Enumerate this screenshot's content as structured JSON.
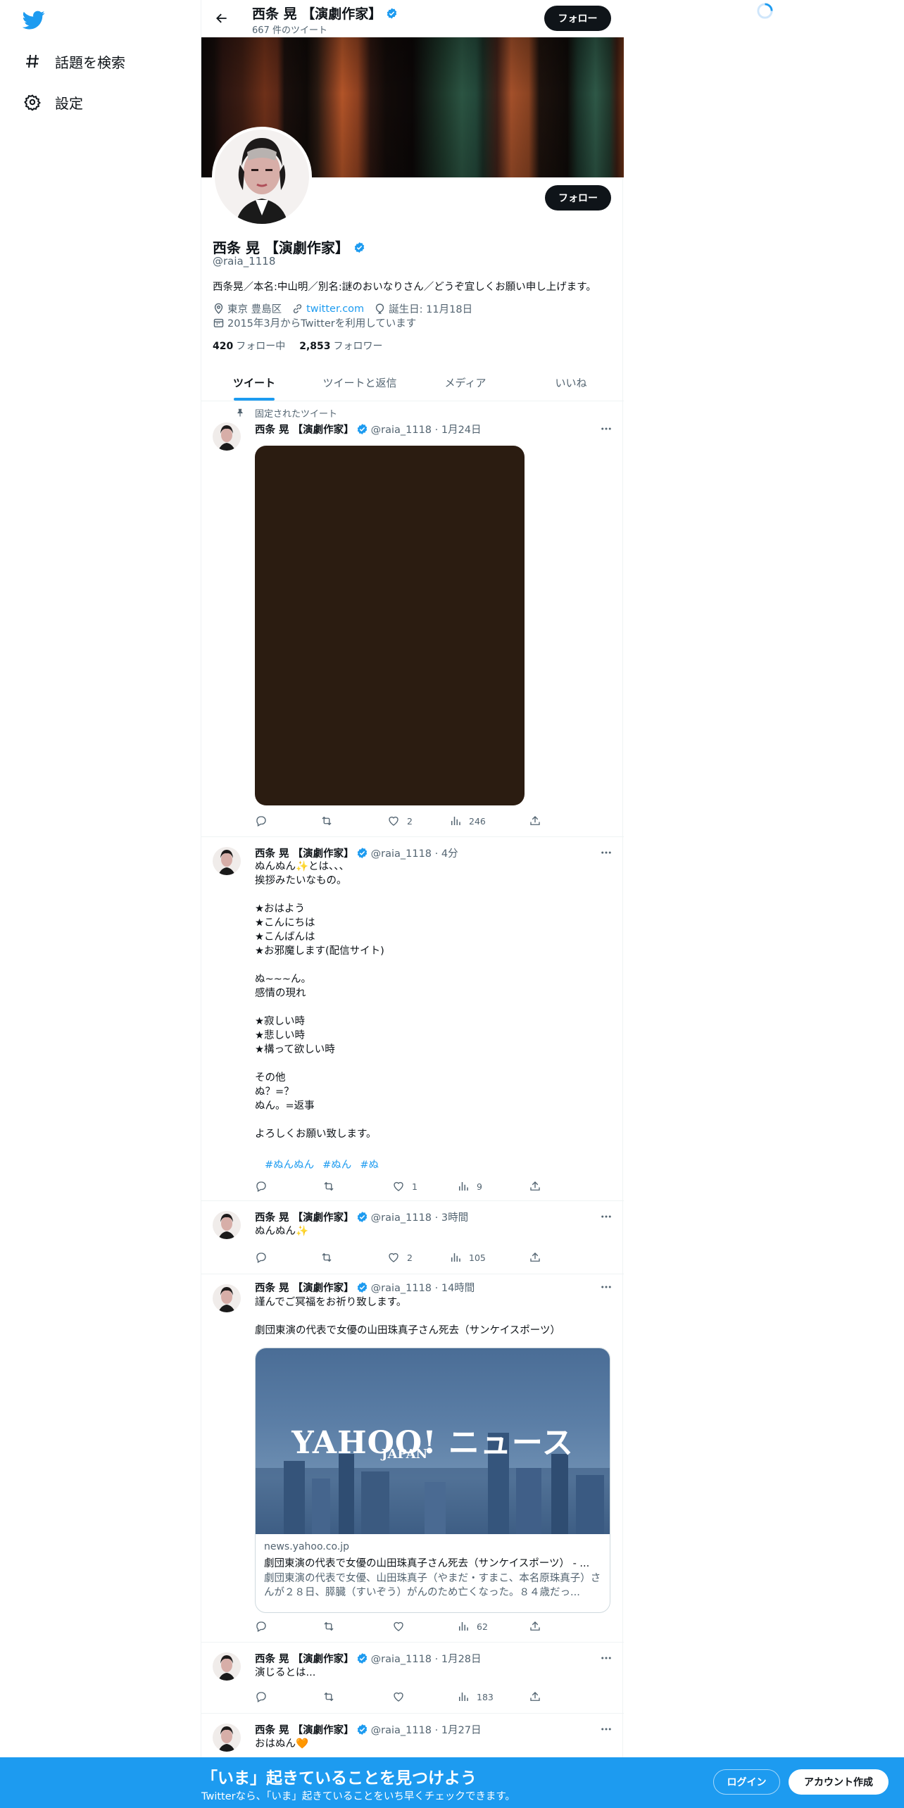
{
  "nav": {
    "logo_icon": "twitter-bird-icon",
    "items": [
      {
        "label": "話題を検索",
        "icon": "hashtag-icon"
      },
      {
        "label": "設定",
        "icon": "gear-icon"
      }
    ]
  },
  "header": {
    "name": "西条 晃 【演劇作家】",
    "tweet_count": "667 件のツイート",
    "follow_label": "フォロー"
  },
  "profile": {
    "name": "西条 晃 【演劇作家】",
    "handle": "@raia_1118",
    "follow_label": "フォロー",
    "bio": "西条晃／本名:中山明／別名:謎のおいなりさん／どうぞ宜しくお願い申し上げます。",
    "location": "東京 豊島区",
    "url": "twitter.com",
    "birthday": "誕生日: 11月18日",
    "joined": "2015年3月からTwitterを利用しています",
    "following_count": "420",
    "following_label": "フォロー中",
    "followers_count": "2,853",
    "followers_label": "フォロワー"
  },
  "tabs": [
    {
      "label": "ツイート",
      "active": true
    },
    {
      "label": "ツイートと返信",
      "active": false
    },
    {
      "label": "メディア",
      "active": false
    },
    {
      "label": "いいね",
      "active": false
    }
  ],
  "tweets": [
    {
      "pinned_label": "固定されたツイート",
      "name": "西条 晃 【演劇作家】",
      "meta": "@raia_1118 · 1月24日",
      "text": "",
      "replies": "",
      "retweets": "",
      "likes": "2",
      "views": "246"
    },
    {
      "name": "西条 晃 【演劇作家】",
      "meta": "@raia_1118 · 4分",
      "text": "ぬんぬん✨とは、、、\n挨拶みたいなもの。\n\n★おはよう\n★こんにちは\n★こんばんは\n★お邪魔します(配信サイト)\n\nぬ~~~ん。\n感情の現れ\n\n★寂しい時\n★悲しい時\n★構って欲しい時\n\nその他\nぬ？=？\nぬん。=返事\n\nよろしくお願い致します。",
      "hashtags": [
        "#ぬんぬん",
        "#ぬん",
        "#ぬ"
      ],
      "replies": "",
      "retweets": "",
      "likes": "1",
      "views": "9"
    },
    {
      "name": "西条 晃 【演劇作家】",
      "meta": "@raia_1118 · 3時間",
      "text": "ぬんぬん✨",
      "replies": "",
      "retweets": "",
      "likes": "2",
      "views": "105"
    },
    {
      "name": "西条 晃 【演劇作家】",
      "meta": "@raia_1118 · 14時間",
      "text": "謹んでご冥福をお祈り致します。\n\n劇団東演の代表で女優の山田珠真子さん死去（サンケイスポーツ）",
      "card": {
        "logo": "YAHOO! ニュース",
        "logo_sub": "JAPAN",
        "domain": "news.yahoo.co.jp",
        "title": "劇団東演の代表で女優の山田珠真子さん死去（サンケイスポーツ） - ...",
        "desc": "劇団東演の代表で女優、山田珠真子（やまだ・すまこ、本名原珠真子）さんが２８日、膵臓（すいぞう）がんのため亡くなった。８４歳だっ..."
      },
      "replies": "",
      "retweets": "",
      "likes": "",
      "views": "62"
    },
    {
      "name": "西条 晃 【演劇作家】",
      "meta": "@raia_1118 · 1月28日",
      "text": "演じるとは...",
      "replies": "",
      "retweets": "",
      "likes": "",
      "views": "183"
    },
    {
      "name": "西条 晃 【演劇作家】",
      "meta": "@raia_1118 · 1月27日",
      "text": "おはぬん🧡"
    }
  ],
  "bottom_bar": {
    "title": "「いま」起きていることを見つけよう",
    "subtitle": "Twitterなら、「いま」起きていることをいち早くチェックできます。",
    "login_label": "ログイン",
    "signup_label": "アカウント作成"
  },
  "colors": {
    "accent": "#1d9bf0",
    "text": "#0f1419",
    "muted": "#536471",
    "bottom_bar": "#1d9bf0"
  }
}
